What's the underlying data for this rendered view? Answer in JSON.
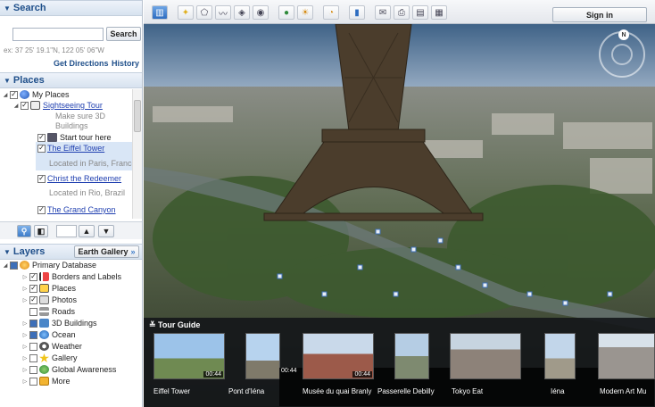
{
  "search": {
    "title": "Search",
    "button": "Search",
    "input_value": "",
    "hint": "ex: 37 25' 19.1\"N, 122 05' 06\"W",
    "get_directions": "Get Directions",
    "history": "History"
  },
  "places": {
    "title": "Places",
    "items": [
      {
        "label": "My Places"
      },
      {
        "label": "Sightseeing Tour"
      },
      {
        "label": "Make sure 3D"
      },
      {
        "label": "Buildings"
      },
      {
        "label": "Start tour here"
      },
      {
        "label": "The Eiffel Tower"
      },
      {
        "label": "Located in Paris, France"
      },
      {
        "label": "Christ the Redeemer"
      },
      {
        "label": "Located in Rio, Brazil"
      },
      {
        "label": "The Grand Canyon"
      }
    ]
  },
  "layers": {
    "title": "Layers",
    "gallery_button": "Earth Gallery",
    "gallery_arrow": "»",
    "items": [
      {
        "label": "Primary Database"
      },
      {
        "label": "Borders and Labels"
      },
      {
        "label": "Places"
      },
      {
        "label": "Photos"
      },
      {
        "label": "Roads"
      },
      {
        "label": "3D Buildings"
      },
      {
        "label": "Ocean"
      },
      {
        "label": "Weather"
      },
      {
        "label": "Gallery"
      },
      {
        "label": "Global Awareness"
      },
      {
        "label": "More"
      }
    ]
  },
  "toolbar": {
    "signin": "Sign in",
    "icons": [
      "sidebar-icon",
      "placemark-icon",
      "polygon-icon",
      "path-icon",
      "image-overlay-icon",
      "record-tour-icon",
      "planet-icon",
      "sun-icon",
      "historical-imagery-icon",
      "ruler-icon",
      "email-icon",
      "print-icon",
      "save-image-icon",
      "maps-icon"
    ]
  },
  "compass": {
    "north": "N"
  },
  "tour_guide": {
    "title": "Tour Guide",
    "items": [
      {
        "label": "Eiffel Tower",
        "duration": "00:44"
      },
      {
        "label": "Pont d'Iéna",
        "duration": "00:44"
      },
      {
        "label": "Musée du quai Branly",
        "duration": "00:44"
      },
      {
        "label": "Passerelle Debilly",
        "duration": ""
      },
      {
        "label": "Tokyo Eat",
        "duration": ""
      },
      {
        "label": "Iéna",
        "duration": ""
      },
      {
        "label": "Modern Art Mu",
        "duration": ""
      }
    ]
  },
  "colors": {
    "panel_header_text": "#1f4f8a",
    "link": "#1f3fb0",
    "sky": "#5a7696",
    "tour_bg": "#14161a"
  }
}
